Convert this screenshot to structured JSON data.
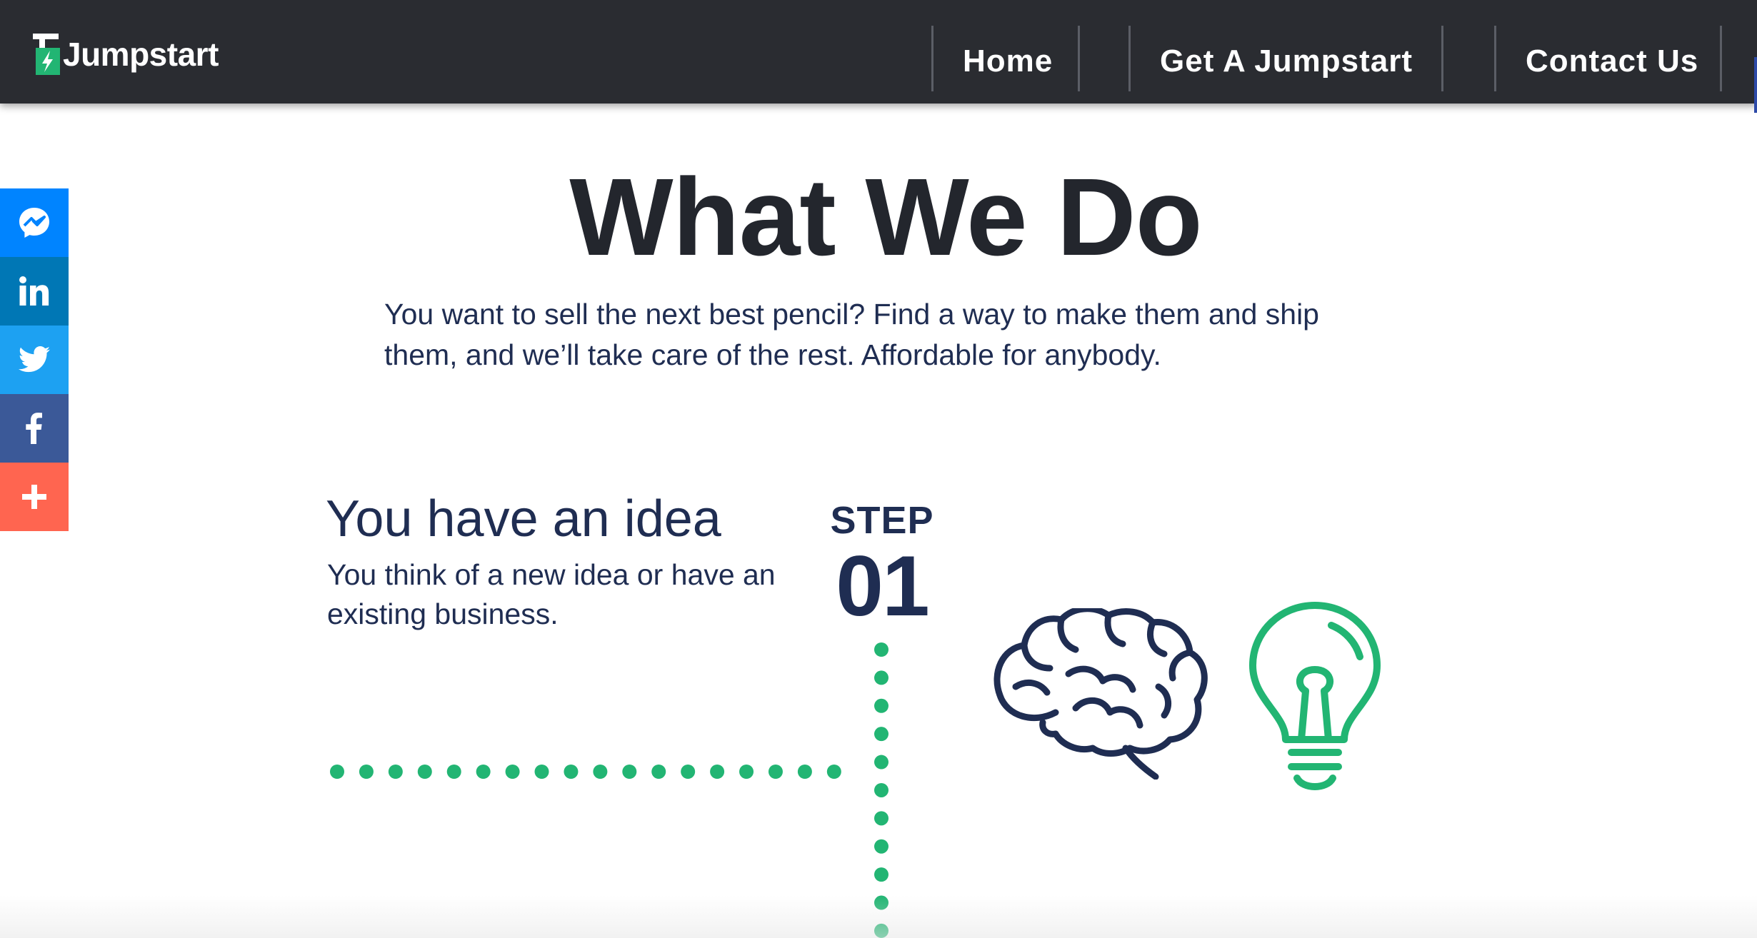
{
  "header": {
    "brand": {
      "name": "Jumpstart",
      "logo_icon": "jumpstart-logo-icon"
    },
    "nav": [
      {
        "label": "Home"
      },
      {
        "label": "Get A Jumpstart"
      },
      {
        "label": "Contact Us"
      }
    ]
  },
  "share_bar": [
    {
      "network": "Messenger",
      "icon": "messenger-icon",
      "color": "#0084ff"
    },
    {
      "network": "LinkedIn",
      "icon": "linkedin-icon",
      "color": "#0077b5"
    },
    {
      "network": "Twitter",
      "icon": "twitter-icon",
      "color": "#1da1f2"
    },
    {
      "network": "Facebook",
      "icon": "facebook-icon",
      "color": "#3b5998"
    },
    {
      "network": "More",
      "icon": "plus-icon",
      "color": "#ff6550"
    }
  ],
  "main": {
    "title": "What We Do",
    "intro": "You want to sell the next best pencil? Find a way to make them and ship them, and we’ll take care of the rest. Affordable for anybody.",
    "step": {
      "heading": "You have an idea",
      "description": "You think of a new idea or have an existing business.",
      "label": "STEP",
      "number": "01",
      "icons": [
        "brain-icon",
        "lightbulb-icon"
      ]
    }
  },
  "colors": {
    "navbar": "#2a2c31",
    "text_dark": "#1f2d52",
    "accent_green": "#22b573"
  }
}
